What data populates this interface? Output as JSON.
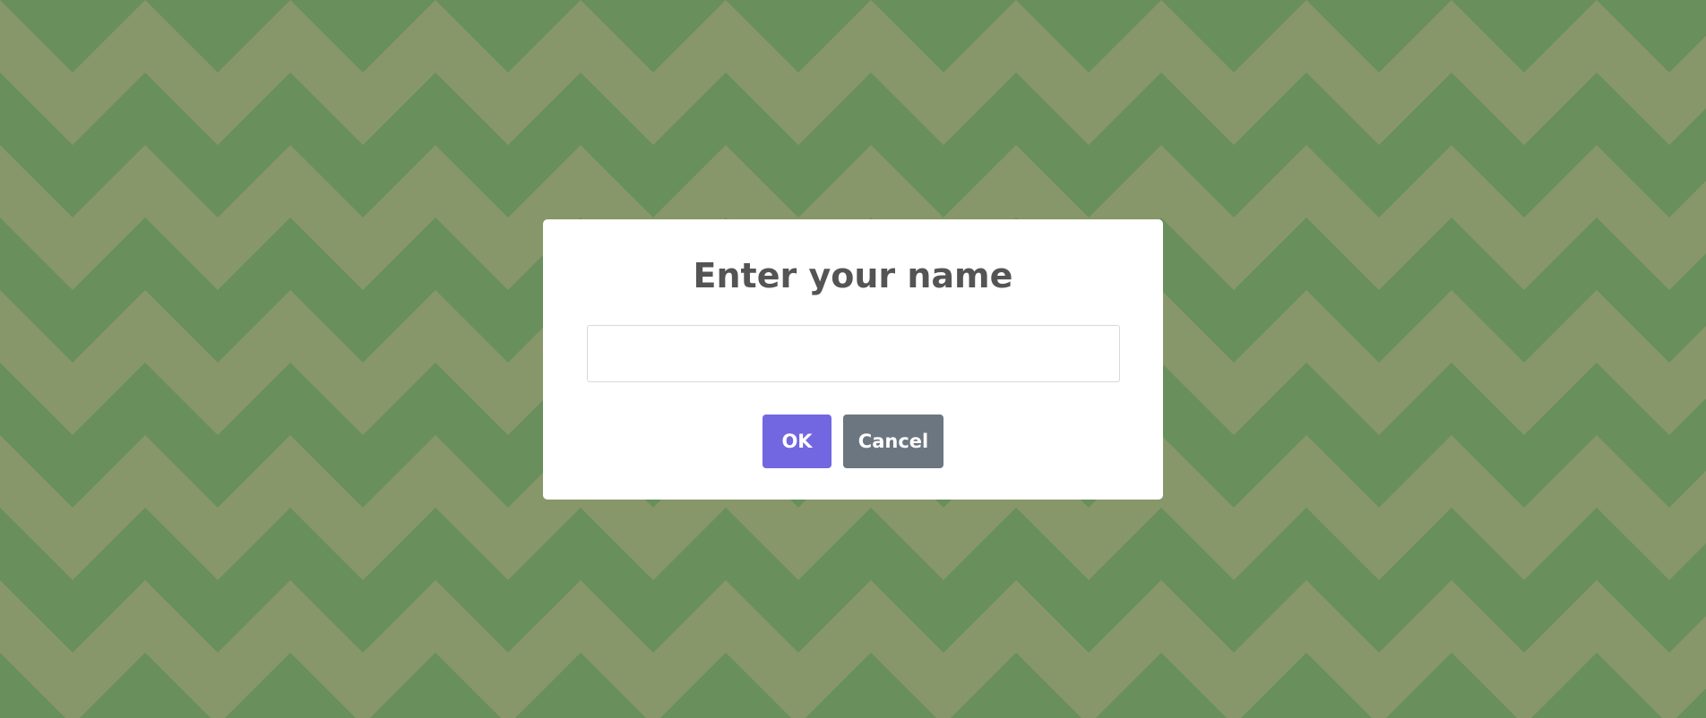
{
  "background": {
    "pattern": "chevron-zigzag",
    "color_dark": "#688f5c",
    "color_light": "#879769"
  },
  "dialog": {
    "title": "Enter your name",
    "input": {
      "value": "",
      "placeholder": ""
    },
    "buttons": {
      "ok_label": "OK",
      "cancel_label": "Cancel"
    },
    "colors": {
      "ok": "#7267e0",
      "cancel": "#6c7680",
      "title": "#545454"
    }
  }
}
